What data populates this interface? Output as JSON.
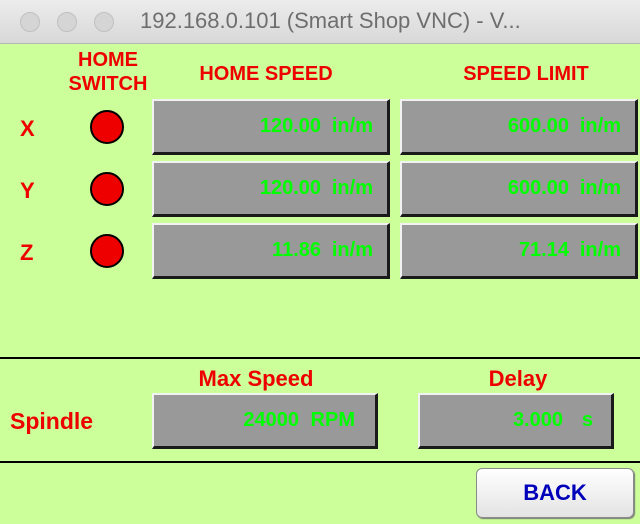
{
  "window": {
    "title": "192.168.0.101 (Smart Shop VNC) - V..."
  },
  "headers": {
    "home_switch": [
      "HOME",
      "SWITCH"
    ],
    "home_speed": "HOME SPEED",
    "speed_limit": "SPEED LIMIT"
  },
  "axes": [
    {
      "label": "X",
      "home_speed": "120.00",
      "speed_limit": "600.00",
      "unit": "in/m"
    },
    {
      "label": "Y",
      "home_speed": "120.00",
      "speed_limit": "600.00",
      "unit": "in/m"
    },
    {
      "label": "Z",
      "home_speed": "11.86",
      "speed_limit": "71.14",
      "unit": "in/m"
    }
  ],
  "spindle": {
    "label": "Spindle",
    "max_speed_label": "Max Speed",
    "max_speed_value": "24000",
    "max_speed_unit": "RPM",
    "delay_label": "Delay",
    "delay_value": "3.000",
    "delay_unit": "s"
  },
  "buttons": {
    "back": "BACK"
  },
  "colors": {
    "background": "#ccff99",
    "header_text": "#ee0000",
    "value_text": "#00ff00",
    "field_bg": "#999999",
    "button_text": "#0000bb"
  }
}
